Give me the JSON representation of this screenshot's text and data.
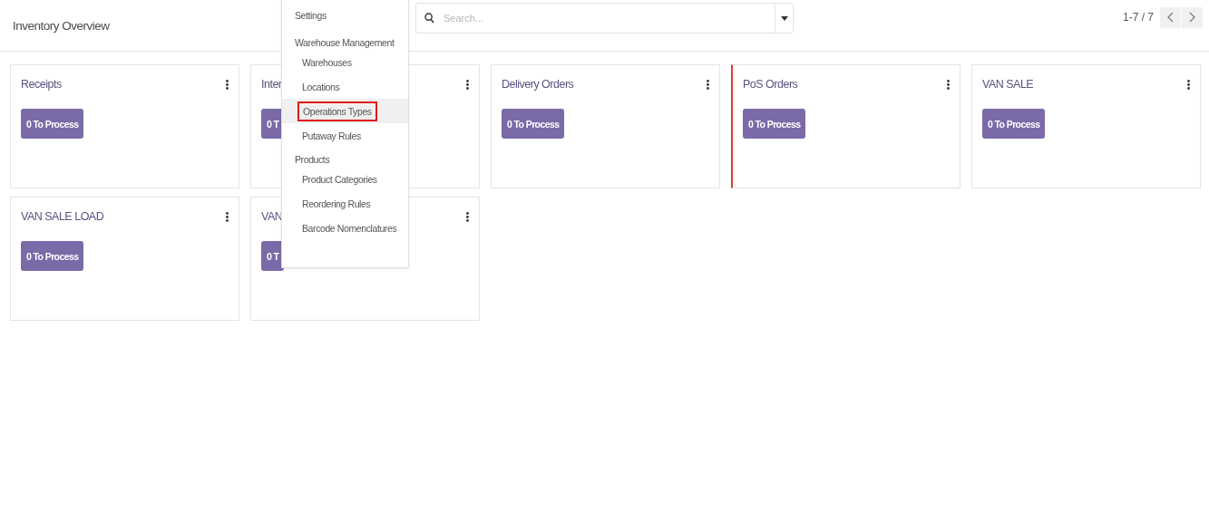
{
  "header": {
    "title": "Inventory Overview",
    "search": {
      "placeholder": "Search..."
    },
    "pager": {
      "range": "1-7 / 7"
    }
  },
  "cards": [
    {
      "title": "Receipts",
      "action": "0 To Process",
      "flagged": false
    },
    {
      "title": "Inter",
      "action": "0 T",
      "flagged": false
    },
    {
      "title": "Delivery Orders",
      "action": "0 To Process",
      "flagged": false
    },
    {
      "title": "PoS Orders",
      "action": "0 To Process",
      "flagged": true
    },
    {
      "title": "VAN SALE",
      "action": "0 To Process",
      "flagged": false
    },
    {
      "title": "VAN SALE LOAD",
      "action": "0 To Process",
      "flagged": false
    },
    {
      "title": "VAN",
      "action": "0 T",
      "flagged": false
    }
  ],
  "menu": [
    {
      "kind": "item",
      "label": "Settings",
      "selected": false
    },
    {
      "kind": "section",
      "label": "Warehouse Management"
    },
    {
      "kind": "subitem",
      "label": "Warehouses",
      "selected": false
    },
    {
      "kind": "subitem",
      "label": "Locations",
      "selected": false
    },
    {
      "kind": "subitem",
      "label": "Operations Types",
      "selected": true
    },
    {
      "kind": "subitem",
      "label": "Putaway Rules",
      "selected": false
    },
    {
      "kind": "section",
      "label": "Products"
    },
    {
      "kind": "subitem",
      "label": "Product Categories",
      "selected": false
    },
    {
      "kind": "subitem",
      "label": "Reordering Rules",
      "selected": false
    },
    {
      "kind": "subitem",
      "label": "Barcode Nomenclatures",
      "selected": false
    }
  ]
}
